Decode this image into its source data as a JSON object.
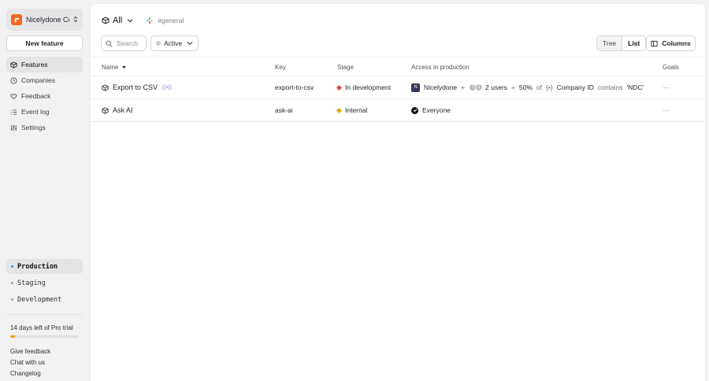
{
  "sidebar": {
    "org_name": "Nicelydone Co",
    "new_feature_label": "New feature",
    "nav": [
      {
        "label": "Features",
        "icon": "box-icon"
      },
      {
        "label": "Companies",
        "icon": "clock-icon"
      },
      {
        "label": "Feedback",
        "icon": "heart-icon"
      },
      {
        "label": "Event log",
        "icon": "list-icon"
      },
      {
        "label": "Settings",
        "icon": "sliders-icon"
      }
    ],
    "environments": [
      {
        "label": "Production",
        "color": "#3b82f6"
      },
      {
        "label": "Staging",
        "color": "#9ca3af"
      },
      {
        "label": "Development",
        "color": "#9ca3af"
      }
    ],
    "trial_text": "14 days left of Pro trial",
    "trial_progress": 0.07,
    "trial_color": "#f0a11b",
    "footer_links": [
      "Give feedback",
      "Chat with us",
      "Changelog"
    ]
  },
  "header": {
    "scope_label": "All",
    "channel": "#general"
  },
  "toolbar": {
    "search_placeholder": "Search",
    "status_filter": "Active",
    "view_tree": "Tree",
    "view_list": "List",
    "columns_label": "Columns"
  },
  "table": {
    "headers": {
      "name": "Name",
      "key": "Key",
      "stage": "Stage",
      "access": "Access in production",
      "goals": "Goals"
    },
    "rows": [
      {
        "name": "Export to CSV",
        "badge": "((•))",
        "key": "export-to-csv",
        "stage": "In development",
        "stage_color": "#e5484d",
        "access": {
          "org_initial": "N",
          "org": "Nicelydone",
          "plus1": "+",
          "avatar_a": "?",
          "avatar_b": "J",
          "users": "2 users",
          "plus2": "+",
          "percent": "50%",
          "of": "of",
          "rule_icon": "{•}",
          "attr": "Company ID",
          "op": "contains",
          "value": "'NDC'"
        },
        "goals": "—"
      },
      {
        "name": "Ask AI",
        "key": "ask-ai",
        "stage": "Internal",
        "stage_color": "#f0a11b",
        "access": {
          "everyone": "Everyone"
        },
        "goals": "—"
      }
    ]
  }
}
